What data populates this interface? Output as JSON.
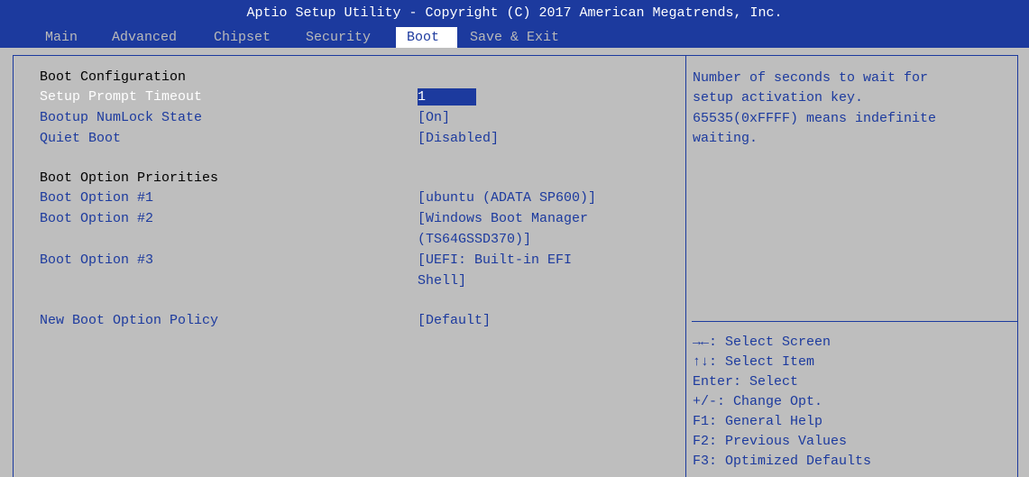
{
  "header": {
    "title": "Aptio Setup Utility - Copyright (C) 2017 American Megatrends, Inc.",
    "tabs": [
      {
        "label": "Main"
      },
      {
        "label": "Advanced"
      },
      {
        "label": "Chipset"
      },
      {
        "label": "Security"
      },
      {
        "label": "Boot"
      },
      {
        "label": "Save & Exit"
      }
    ],
    "active_tab": "Boot"
  },
  "main": {
    "section_boot_configuration": "Boot Configuration",
    "setup_prompt_timeout": {
      "label": "Setup Prompt Timeout",
      "value": "1"
    },
    "bootup_numlock_state": {
      "label": "Bootup NumLock State",
      "value": "[On]"
    },
    "quiet_boot": {
      "label": "Quiet Boot",
      "value": "[Disabled]"
    },
    "section_boot_option_priorities": "Boot Option Priorities",
    "boot_option_1": {
      "label": "Boot Option #1",
      "value": "[ubuntu (ADATA SP600)]"
    },
    "boot_option_2": {
      "label": "Boot Option #2",
      "value_line1": "[Windows Boot Manager",
      "value_line2": "(TS64GSSD370)]"
    },
    "boot_option_3": {
      "label": "Boot Option #3",
      "value_line1": "[UEFI: Built-in EFI",
      "value_line2": "Shell]"
    },
    "new_boot_option_policy": {
      "label": "New Boot Option Policy",
      "value": "[Default]"
    }
  },
  "help": {
    "lines": [
      "Number of seconds to wait for",
      "setup activation key.",
      "65535(0xFFFF) means indefinite",
      "waiting."
    ]
  },
  "keys": {
    "lines": [
      "→←: Select Screen",
      "↑↓: Select Item",
      "Enter: Select",
      "+/-: Change Opt.",
      "F1: General Help",
      "F2: Previous Values",
      "F3: Optimized Defaults"
    ]
  },
  "colors": {
    "header_bg": "#1c3a9e",
    "body_bg": "#bebebe",
    "text_blue": "#1c3a9e",
    "highlight_bg": "#1c3a9e",
    "active_tab_bg": "#ffffff"
  }
}
